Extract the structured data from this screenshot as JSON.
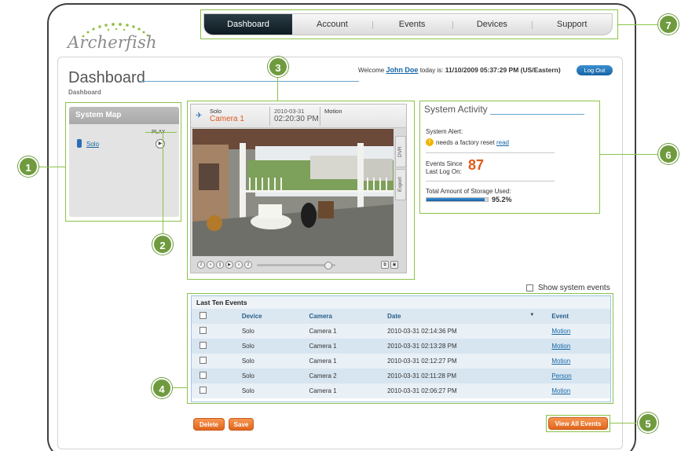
{
  "logo": {
    "text": "Archerfish"
  },
  "nav": {
    "tabs": [
      "Dashboard",
      "Account",
      "Events",
      "Devices",
      "Support"
    ],
    "active": "Dashboard"
  },
  "page": {
    "title": "Dashboard",
    "breadcrumb": "Dashboard"
  },
  "header": {
    "welcome_prefix": "Welcome",
    "user": "John Doe",
    "today_label": "today is:",
    "datetime": "11/10/2009 05:37:29 PM (US/Eastern)",
    "logout_label": "Log Out"
  },
  "system_map": {
    "title": "System Map",
    "play_label": "PLAY",
    "device_link": "Solo"
  },
  "video": {
    "device": "Solo",
    "camera": "Camera 1",
    "date": "2010-03-31",
    "time": "02:20:30 PM",
    "event": "Motion",
    "side_tabs": [
      "DVR",
      "Export"
    ],
    "controls": [
      "2",
      "«",
      "||",
      "▶",
      "»",
      "2"
    ]
  },
  "activity": {
    "title": "System Activity",
    "alert_label": "System Alert:",
    "alert_text": "needs a factory reset",
    "alert_link": "read",
    "events_since_label": "Events Since Last Log On:",
    "events_since_count": "87",
    "storage_label": "Total Amount of Storage Used:",
    "storage_pct": "95.2%",
    "storage_fraction": 0.952
  },
  "show_system_events": "Show system events",
  "events": {
    "title": "Last Ten Events",
    "columns": [
      "Device",
      "Camera",
      "Date",
      "Event"
    ],
    "rows": [
      {
        "device": "Solo",
        "camera": "Camera 1",
        "date": "2010-03-31 02:14:36 PM",
        "event": "Motion"
      },
      {
        "device": "Solo",
        "camera": "Camera 1",
        "date": "2010-03-31 02:13:28 PM",
        "event": "Motion"
      },
      {
        "device": "Solo",
        "camera": "Camera 1",
        "date": "2010-03-31 02:12:27 PM",
        "event": "Motion"
      },
      {
        "device": "Solo",
        "camera": "Camera 2",
        "date": "2010-03-31 02:11:28 PM",
        "event": "Person"
      },
      {
        "device": "Solo",
        "camera": "Camera 1",
        "date": "2010-03-31 02:06:27 PM",
        "event": "Motion"
      }
    ]
  },
  "buttons": {
    "delete": "Delete",
    "save": "Save",
    "view_all": "View All Events"
  },
  "callouts": [
    "1",
    "2",
    "3",
    "4",
    "5",
    "6",
    "7"
  ],
  "colors": {
    "accent_orange": "#e05a1a",
    "link_blue": "#1466a6",
    "callout_green": "#6f9b3e",
    "nav_active": "#0d1b22"
  }
}
